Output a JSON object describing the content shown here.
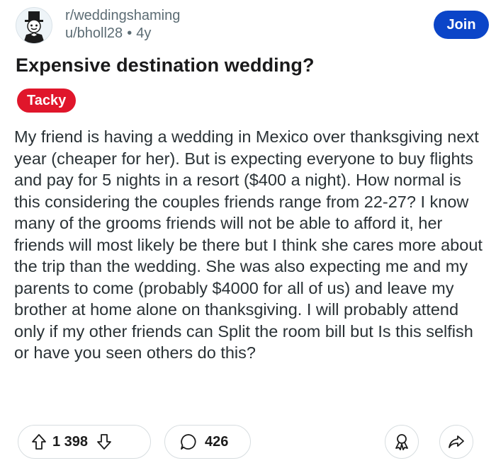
{
  "post": {
    "subreddit": "r/weddingshaming",
    "username": "u/bholl28",
    "separator": "•",
    "age": "4y",
    "join_label": "Join",
    "title": "Expensive destination wedding?",
    "flair": "Tacky",
    "flair_color": "#e0162b",
    "body": "My friend is having a wedding in Mexico over thanksgiving next year (cheaper for her). But is expecting everyone to buy flights and pay for 5 nights in a resort ($400 a night). How normal is this considering the couples friends range from 22-27? I know many of the grooms friends will not be able to afford it, her friends will most likely be there but I think she cares more about the trip than the wedding. She was also expecting me and my parents to come (probably $4000 for all of us) and leave my brother at home alone on thanksgiving. I will probably attend only if my other friends can Split the room bill but Is this selfish or have you seen others do this?"
  },
  "actions": {
    "upvotes": "1 398",
    "comments": "426",
    "icons": [
      "upvote-icon",
      "downvote-icon",
      "comment-icon",
      "award-icon",
      "share-icon"
    ]
  },
  "colors": {
    "join_button": "#0b45c8",
    "meta_text": "#5c6c74"
  }
}
